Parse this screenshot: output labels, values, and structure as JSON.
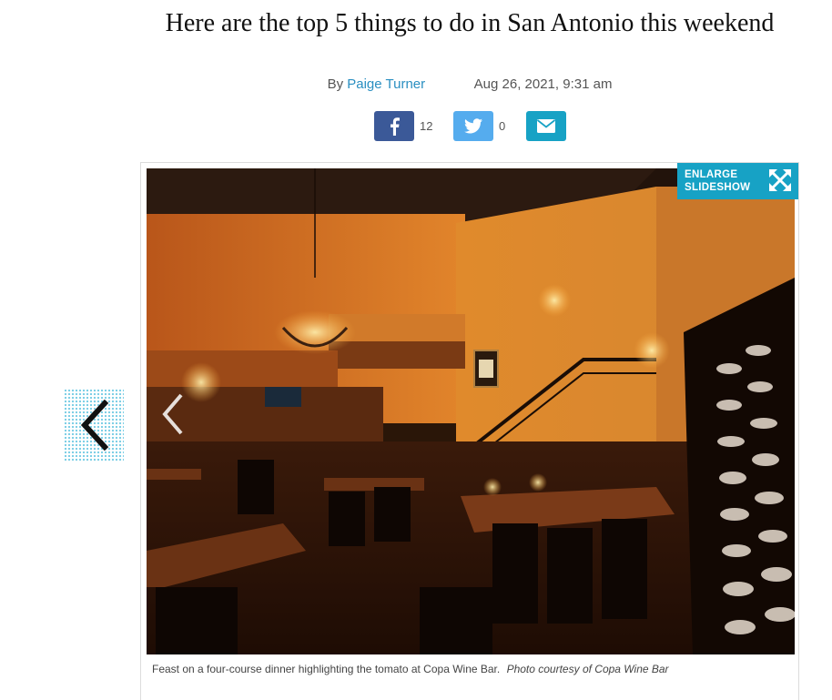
{
  "article": {
    "headline": "Here are the top 5 things to do in San Antonio this weekend",
    "byline_prefix": "By",
    "author": "Paige Turner",
    "timestamp": "Aug 26, 2021, 9:31 am"
  },
  "share": {
    "facebook_icon": "facebook-icon",
    "facebook_count": "12",
    "twitter_icon": "twitter-icon",
    "twitter_count": "0",
    "email_icon": "envelope-icon"
  },
  "gallery": {
    "enlarge_label_line1": "ENLARGE",
    "enlarge_label_line2": "SLIDESHOW",
    "enlarge_icon": "expand-arrows-icon",
    "prev_icon": "chevron-left-icon",
    "caption": "Feast on a four-course dinner highlighting the tomato at Copa Wine Bar.",
    "credit": "Photo courtesy of Copa Wine Bar"
  },
  "colors": {
    "accent": "#17a2c5",
    "facebook": "#3b5998",
    "twitter": "#55acee",
    "link": "#2a8fc1"
  }
}
